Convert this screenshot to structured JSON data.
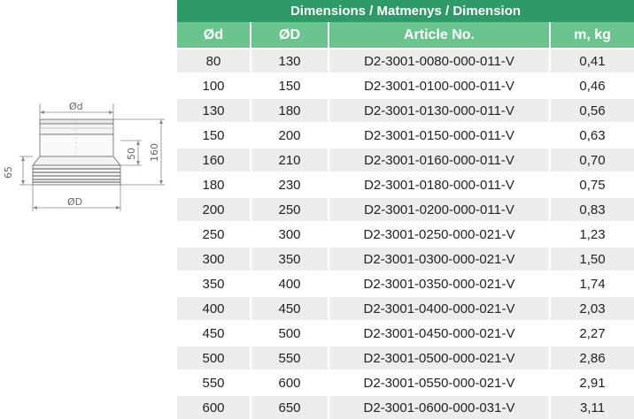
{
  "drawing": {
    "labels": {
      "small_diameter": "Ød",
      "large_diameter": "ØD",
      "height_65": "65",
      "height_50": "50",
      "height_160": "160"
    }
  },
  "table": {
    "title": "Dimensions / Matmenys / Dimension",
    "headers": [
      "Ød",
      "ØD",
      "Article No.",
      "m, kg"
    ],
    "rows": [
      [
        "80",
        "130",
        "D2-3001-0080-000-011-V",
        "0,41"
      ],
      [
        "100",
        "150",
        "D2-3001-0100-000-011-V",
        "0,46"
      ],
      [
        "130",
        "180",
        "D2-3001-0130-000-011-V",
        "0,56"
      ],
      [
        "150",
        "200",
        "D2-3001-0150-000-011-V",
        "0,63"
      ],
      [
        "160",
        "210",
        "D2-3001-0160-000-011-V",
        "0,70"
      ],
      [
        "180",
        "230",
        "D2-3001-0180-000-011-V",
        "0,75"
      ],
      [
        "200",
        "250",
        "D2-3001-0200-000-011-V",
        "0,83"
      ],
      [
        "250",
        "300",
        "D2-3001-0250-000-021-V",
        "1,23"
      ],
      [
        "300",
        "350",
        "D2-3001-0300-000-021-V",
        "1,50"
      ],
      [
        "350",
        "400",
        "D2-3001-0350-000-021-V",
        "1,74"
      ],
      [
        "400",
        "450",
        "D2-3001-0400-000-021-V",
        "2,03"
      ],
      [
        "450",
        "500",
        "D2-3001-0450-000-021-V",
        "2,27"
      ],
      [
        "500",
        "550",
        "D2-3001-0500-000-021-V",
        "2,86"
      ],
      [
        "550",
        "600",
        "D2-3001-0550-000-021-V",
        "2,91"
      ],
      [
        "600",
        "650",
        "D2-3001-0600-000-031-V",
        "3,11"
      ]
    ]
  }
}
